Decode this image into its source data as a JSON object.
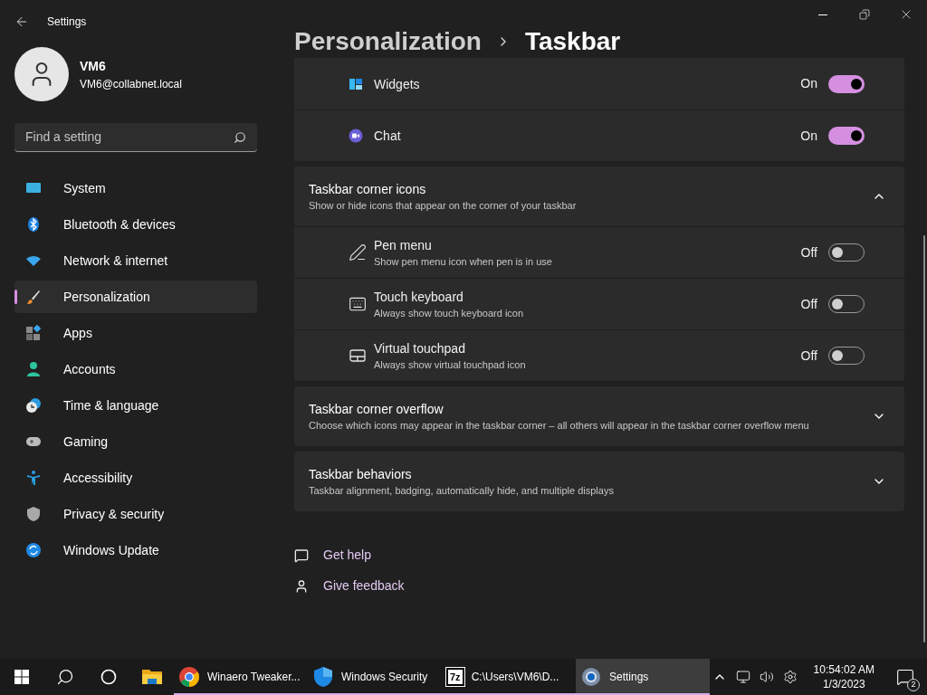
{
  "window": {
    "title": "Settings"
  },
  "user": {
    "name": "VM6",
    "email": "VM6@collabnet.local"
  },
  "search": {
    "placeholder": "Find a setting"
  },
  "nav": [
    {
      "kind": "system",
      "label": "System",
      "selected": false
    },
    {
      "kind": "bluetooth",
      "label": "Bluetooth & devices",
      "selected": false
    },
    {
      "kind": "network",
      "label": "Network & internet",
      "selected": false
    },
    {
      "kind": "personalization",
      "label": "Personalization",
      "selected": true
    },
    {
      "kind": "apps",
      "label": "Apps",
      "selected": false
    },
    {
      "kind": "accounts",
      "label": "Accounts",
      "selected": false
    },
    {
      "kind": "time",
      "label": "Time & language",
      "selected": false
    },
    {
      "kind": "gaming",
      "label": "Gaming",
      "selected": false
    },
    {
      "kind": "accessibility",
      "label": "Accessibility",
      "selected": false
    },
    {
      "kind": "privacy",
      "label": "Privacy & security",
      "selected": false
    },
    {
      "kind": "update",
      "label": "Windows Update",
      "selected": false
    }
  ],
  "breadcrumb": [
    "Personalization",
    "Taskbar"
  ],
  "group_tail": {
    "rows": [
      {
        "kind": "widgets",
        "label": "Widgets",
        "state_text": "On",
        "on": true
      },
      {
        "kind": "chat",
        "label": "Chat",
        "state_text": "On",
        "on": true
      }
    ]
  },
  "sections": [
    {
      "title": "Taskbar corner icons",
      "description": "Show or hide icons that appear on the corner of your taskbar",
      "expanded": true,
      "rows": [
        {
          "kind": "pen",
          "label": "Pen menu",
          "description": "Show pen menu icon when pen is in use",
          "state_text": "Off",
          "on": false
        },
        {
          "kind": "keyboard",
          "label": "Touch keyboard",
          "description": "Always show touch keyboard icon",
          "state_text": "Off",
          "on": false
        },
        {
          "kind": "touchpad",
          "label": "Virtual touchpad",
          "description": "Always show virtual touchpad icon",
          "state_text": "Off",
          "on": false
        }
      ]
    },
    {
      "title": "Taskbar corner overflow",
      "description": "Choose which icons may appear in the taskbar corner – all others will appear in the taskbar corner overflow menu",
      "expanded": false
    },
    {
      "title": "Taskbar behaviors",
      "description": "Taskbar alignment, badging, automatically hide, and multiple displays",
      "expanded": false
    }
  ],
  "links": [
    {
      "kind": "help",
      "label": "Get help"
    },
    {
      "kind": "feedback",
      "label": "Give feedback"
    }
  ],
  "taskbar": {
    "apps": [
      {
        "kind": "start",
        "running": false,
        "selected": false
      },
      {
        "kind": "search",
        "running": false,
        "selected": false
      },
      {
        "kind": "cortana",
        "running": false,
        "selected": false
      },
      {
        "kind": "explorer",
        "running": false,
        "selected": false
      },
      {
        "kind": "chrome",
        "label": "Winaero Tweaker...",
        "running": true,
        "selected": false
      },
      {
        "kind": "security",
        "label": "Windows Security",
        "running": true,
        "selected": false
      },
      {
        "kind": "sevenzip",
        "icon_text": "7z",
        "label": "C:\\Users\\VM6\\D...",
        "running": true,
        "selected": false
      },
      {
        "kind": "settings",
        "label": "Settings",
        "running": true,
        "selected": true
      }
    ],
    "clock": {
      "time": "10:54:02 AM",
      "date": "1/3/2023"
    },
    "notifications": "2"
  }
}
